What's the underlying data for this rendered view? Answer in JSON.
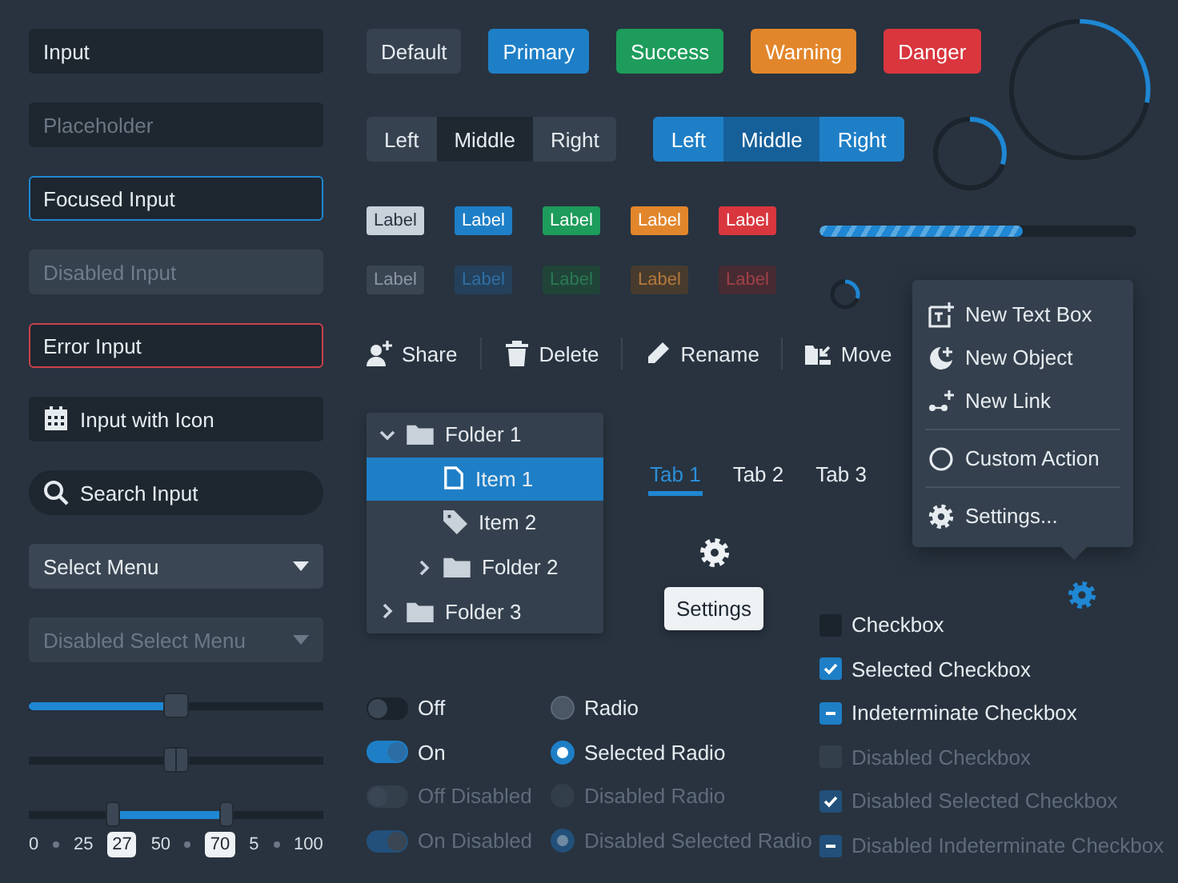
{
  "inputs": [
    {
      "kind": "text",
      "value": "Input",
      "focused": false,
      "error": false,
      "disabled": false
    },
    {
      "kind": "text",
      "placeholder": "Placeholder",
      "focused": false,
      "error": false,
      "disabled": false
    },
    {
      "kind": "text",
      "value": "Focused Input",
      "focused": true,
      "error": false,
      "disabled": false
    },
    {
      "kind": "text",
      "value": "Disabled Input",
      "focused": false,
      "error": false,
      "disabled": true
    },
    {
      "kind": "text",
      "value": "Error Input",
      "focused": false,
      "error": true,
      "disabled": false
    },
    {
      "kind": "date",
      "value": "Input with Icon",
      "focused": false,
      "error": false,
      "disabled": false
    },
    {
      "kind": "search",
      "value": "Search Input",
      "focused": false,
      "error": false,
      "disabled": false
    },
    {
      "kind": "select",
      "value": "Select Menu",
      "focused": false,
      "error": false,
      "disabled": false
    },
    {
      "kind": "select",
      "value": "Disabled Select Menu",
      "focused": false,
      "error": false,
      "disabled": true
    }
  ],
  "sliders": [
    {
      "kind": "single",
      "level": 0.5
    },
    {
      "kind": "plain",
      "level": 0.5
    },
    {
      "kind": "range",
      "thumbs": [
        {
          "level": 0.28
        },
        {
          "level": 0.67
        }
      ]
    }
  ],
  "slider_scale": [
    {
      "kind": "label",
      "text": "0"
    },
    {
      "kind": "dot"
    },
    {
      "kind": "label",
      "text": "25"
    },
    {
      "kind": "value",
      "text": "27"
    },
    {
      "kind": "label",
      "text": "50"
    },
    {
      "kind": "dot"
    },
    {
      "kind": "value",
      "text": "70"
    },
    {
      "kind": "label",
      "text": "5"
    },
    {
      "kind": "dot"
    },
    {
      "kind": "label",
      "text": "100"
    }
  ],
  "buttons": [
    {
      "label": "Default",
      "kind": "default"
    },
    {
      "label": "Primary",
      "kind": "primary"
    },
    {
      "label": "Success",
      "kind": "success"
    },
    {
      "label": "Warning",
      "kind": "warning"
    },
    {
      "label": "Danger",
      "kind": "danger"
    }
  ],
  "progress_rings": [
    {
      "level": 0.28
    },
    {
      "level": 0.3
    }
  ],
  "button_groups": [
    {
      "kind": "default",
      "items": [
        {
          "label": "Left",
          "selected": false
        },
        {
          "label": "Middle",
          "selected": true
        },
        {
          "label": "Right",
          "selected": false
        }
      ]
    },
    {
      "kind": "primary",
      "items": [
        {
          "label": "Left",
          "selected": false
        },
        {
          "label": "Middle",
          "selected": true
        },
        {
          "label": "Right",
          "selected": false
        }
      ]
    }
  ],
  "label_rows": [
    {
      "subtle": false,
      "items": [
        {
          "text": "Label",
          "kind": "default"
        },
        {
          "text": "Label",
          "kind": "primary"
        },
        {
          "text": "Label",
          "kind": "success"
        },
        {
          "text": "Label",
          "kind": "warning"
        },
        {
          "text": "Label",
          "kind": "danger"
        }
      ]
    },
    {
      "subtle": true,
      "items": [
        {
          "text": "Label",
          "kind": "default"
        },
        {
          "text": "Label",
          "kind": "primary"
        },
        {
          "text": "Label",
          "kind": "success"
        },
        {
          "text": "Label",
          "kind": "warning"
        },
        {
          "text": "Label",
          "kind": "danger"
        }
      ]
    }
  ],
  "progress_bar": {
    "level": 0.64
  },
  "toolbar": [
    {
      "label": "Share"
    },
    {
      "label": "Delete"
    },
    {
      "label": "Rename"
    },
    {
      "label": "Move"
    }
  ],
  "menu": [
    {
      "kind": "item",
      "label": "New Text Box"
    },
    {
      "kind": "item",
      "label": "New Object"
    },
    {
      "kind": "item",
      "label": "New Link"
    },
    {
      "kind": "divider"
    },
    {
      "kind": "item",
      "label": "Custom Action"
    },
    {
      "kind": "divider"
    },
    {
      "kind": "item",
      "label": "Settings..."
    }
  ],
  "tree": [
    {
      "kind": "folder",
      "label": "Folder 1",
      "expanded": true,
      "selected": false,
      "children": [
        {
          "kind": "file",
          "label": "Item 1",
          "selected": true
        },
        {
          "kind": "tag",
          "label": "Item 2",
          "selected": false
        },
        {
          "kind": "folder",
          "label": "Folder 2",
          "expanded": false,
          "selected": false
        }
      ]
    },
    {
      "kind": "folder",
      "label": "Folder 3",
      "expanded": false,
      "selected": false
    }
  ],
  "tabs": [
    {
      "label": "Tab 1",
      "selected": true
    },
    {
      "label": "Tab 2",
      "selected": false
    },
    {
      "label": "Tab 3",
      "selected": false
    }
  ],
  "tooltip": {
    "text": "Settings"
  },
  "toggles": [
    {
      "label": "Off",
      "on": false,
      "disabled": false
    },
    {
      "label": "On",
      "on": true,
      "disabled": false
    },
    {
      "label": "Off Disabled",
      "on": false,
      "disabled": true
    },
    {
      "label": "On Disabled",
      "on": true,
      "disabled": true
    }
  ],
  "radios": [
    {
      "label": "Radio",
      "selected": false,
      "disabled": false
    },
    {
      "label": "Selected Radio",
      "selected": true,
      "disabled": false
    },
    {
      "label": "Disabled Radio",
      "selected": false,
      "disabled": true
    },
    {
      "label": "Disabled Selected Radio",
      "selected": true,
      "disabled": true
    }
  ],
  "checkboxes": [
    {
      "label": "Checkbox",
      "checked": false,
      "indeterminate": false,
      "disabled": false
    },
    {
      "label": "Selected Checkbox",
      "checked": true,
      "indeterminate": false,
      "disabled": false
    },
    {
      "label": "Indeterminate Checkbox",
      "checked": true,
      "indeterminate": true,
      "disabled": false
    },
    {
      "label": "Disabled Checkbox",
      "checked": false,
      "indeterminate": false,
      "disabled": true
    },
    {
      "label": "Disabled Selected Checkbox",
      "checked": true,
      "indeterminate": false,
      "disabled": true
    },
    {
      "label": "Disabled Indeterminate Checkbox",
      "checked": true,
      "indeterminate": true,
      "disabled": true
    }
  ]
}
